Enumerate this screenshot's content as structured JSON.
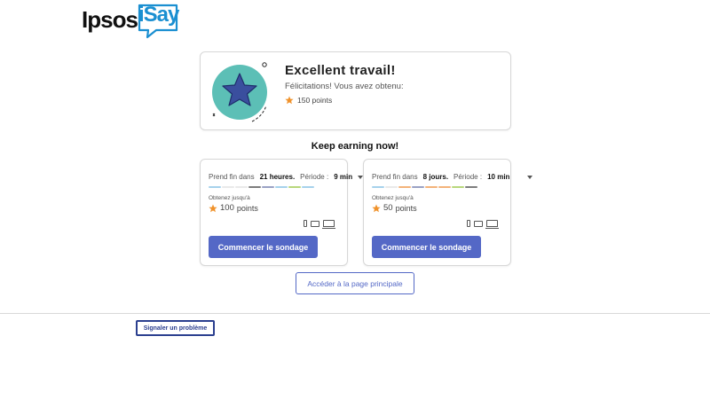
{
  "brand": {
    "ipsos": "Ipsos",
    "isay": "iSay"
  },
  "success": {
    "title": "Excellent travail!",
    "subtitle": "Félicitations! Vous avez obtenu:",
    "points": "150 points"
  },
  "section_title": "Keep earning now!",
  "surveys": [
    {
      "ends_prefix": "Prend fin dans",
      "ends_value": "21 heures.",
      "period_label": "Période :",
      "duration": "9 min",
      "until_label": "Obtenez jusqu'à",
      "points_value": "100",
      "points_unit": "points",
      "bar_colors": [
        "#a6d2ec",
        "#e9e9e9",
        "#e9e9e9",
        "#7d7d7d",
        "#9aa2c4",
        "#a6d2ec",
        "#b8d77c",
        "#a6d2ec"
      ],
      "devices": [
        "phone-icon",
        "tablet-icon",
        "laptop-icon"
      ],
      "button_label": "Commencer le sondage"
    },
    {
      "ends_prefix": "Prend fin dans",
      "ends_value": "8 jours.",
      "period_label": "Période :",
      "duration": "10 min",
      "until_label": "Obtenez jusqu'à",
      "points_value": "50",
      "points_unit": "points",
      "bar_colors": [
        "#a6d2ec",
        "#e9e9e9",
        "#f3b37a",
        "#9aa2c4",
        "#f3b37a",
        "#f3b37a",
        "#b8d77c",
        "#7d7d7d"
      ],
      "devices": [
        "phone-icon",
        "tablet-icon",
        "laptop-icon"
      ],
      "button_label": "Commencer le sondage"
    }
  ],
  "home_button": "Accéder à la page principale",
  "report_button": "Signaler un problème",
  "colors": {
    "primary": "#5468c6",
    "star": "#f0922b",
    "illustration_circle": "#5cbfb6",
    "illustration_star": "#3a4f9e",
    "report_border": "#2b3f8f"
  }
}
